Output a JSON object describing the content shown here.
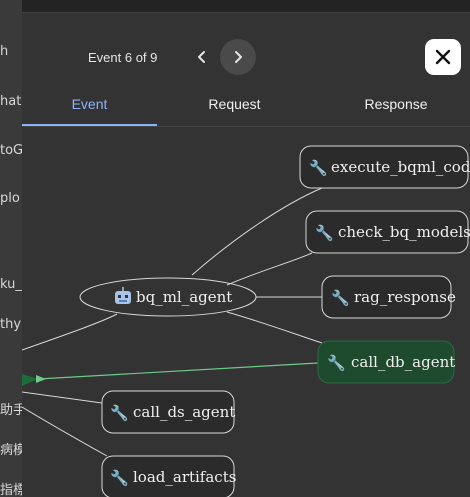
{
  "left_panel": {
    "items": [
      "h",
      "hatC",
      "toG",
      "plo",
      "ku_",
      "thy",
      "助手",
      "病模",
      "指標"
    ]
  },
  "dialog": {
    "event_counter": "Event 6 of 9",
    "tabs": [
      {
        "label": "Event",
        "active": true
      },
      {
        "label": "Request",
        "active": false
      },
      {
        "label": "Response",
        "active": false
      }
    ]
  },
  "graph": {
    "center_node": {
      "label": "bq_ml_agent",
      "icon": "robot-icon"
    },
    "tool_nodes": [
      {
        "label": "execute_bqml_code",
        "icon": "wrench-icon"
      },
      {
        "label": "check_bq_models",
        "icon": "wrench-icon"
      },
      {
        "label": "rag_response",
        "icon": "wrench-icon"
      },
      {
        "label": "call_db_agent",
        "icon": "wrench-icon",
        "highlighted": true
      },
      {
        "label": "call_ds_agent",
        "icon": "wrench-icon"
      },
      {
        "label": "load_artifacts",
        "icon": "wrench-icon"
      }
    ],
    "colors": {
      "highlight_fill": "#1e4a2d",
      "highlight_edge": "#6fc98a",
      "tab_active": "#8ab4f8"
    }
  }
}
